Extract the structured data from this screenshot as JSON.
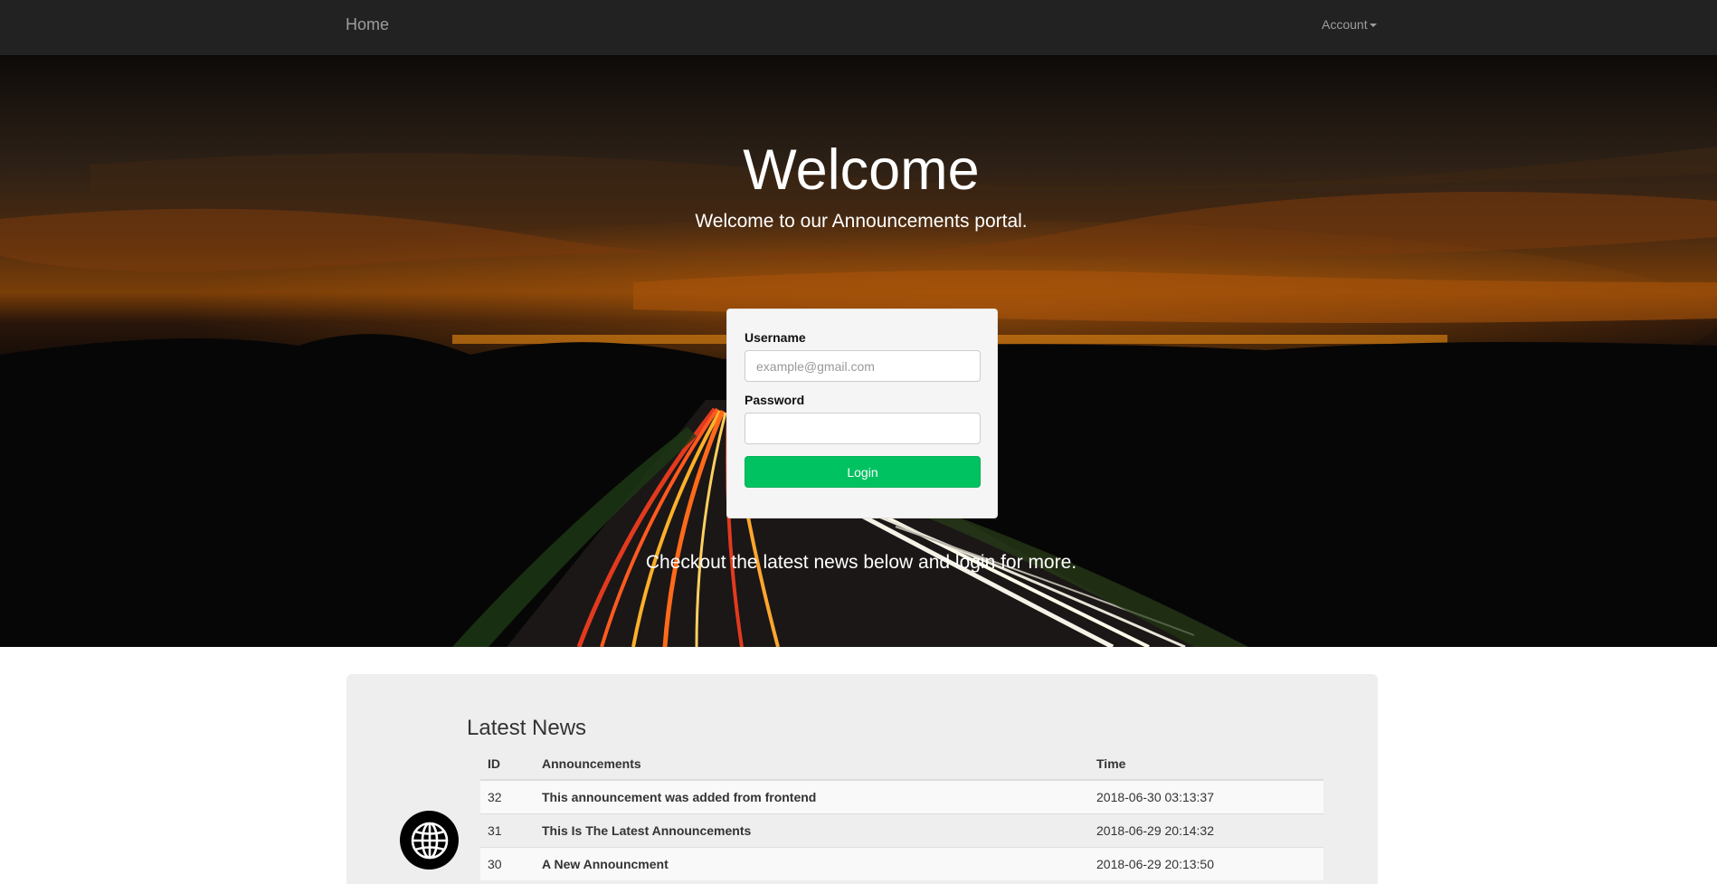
{
  "navbar": {
    "home_label": "Home",
    "account_label": "Account",
    "account_icon": "caret-down-icon"
  },
  "hero": {
    "title": "Welcome",
    "subtitle": "Welcome to our Announcements portal.",
    "footer_text": "Checkout the latest news below and login for more."
  },
  "login": {
    "username_label": "Username",
    "username_placeholder": "example@gmail.com",
    "username_value": "",
    "password_label": "Password",
    "password_value": "",
    "submit_label": "Login",
    "submit_color": "#00c260"
  },
  "news": {
    "title": "Latest News",
    "columns": [
      "ID",
      "Announcements",
      "Time"
    ],
    "rows": [
      {
        "id": "32",
        "announcement": "This announcement was added from frontend",
        "time": "2018-06-30 03:13:37"
      },
      {
        "id": "31",
        "announcement": "This Is The Latest Announcements",
        "time": "2018-06-29 20:14:32"
      },
      {
        "id": "30",
        "announcement": "A New Announcment",
        "time": "2018-06-29 20:13:50"
      }
    ]
  },
  "floating_button": {
    "icon": "globe-icon"
  }
}
